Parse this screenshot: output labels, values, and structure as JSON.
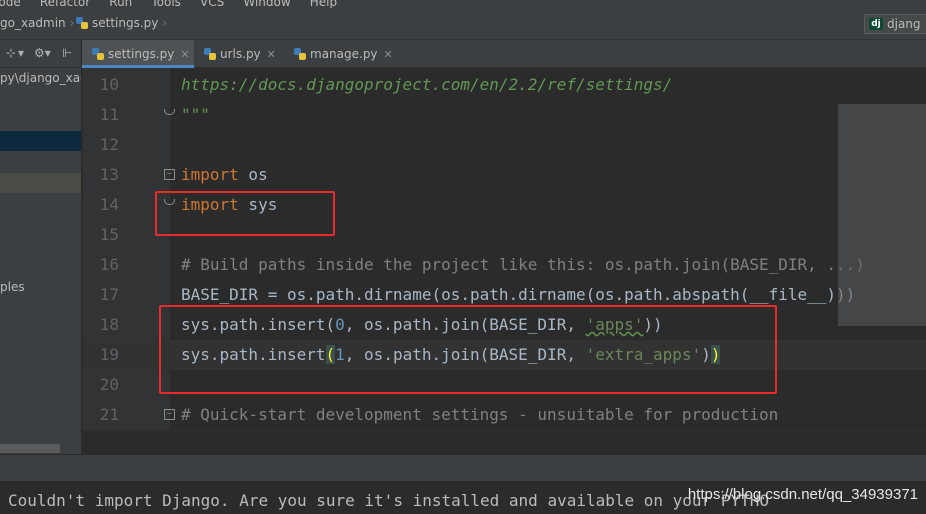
{
  "menubar": {
    "items": [
      "Code",
      "Refactor",
      "Run",
      "Tools",
      "VCS",
      "Window",
      "Help"
    ]
  },
  "breadcrumb": {
    "project": "go_xadmin",
    "file": "settings.py"
  },
  "run_config": {
    "badge": "dj",
    "label": "djang"
  },
  "sidebar": {
    "tool_icons": [
      "⊹",
      "▾",
      "⚙▾",
      "⊩"
    ],
    "path_text": "py\\django_xad",
    "libraries_text": "ples"
  },
  "tabs": [
    {
      "label": "settings.py",
      "active": true
    },
    {
      "label": "urls.py",
      "active": false
    },
    {
      "label": "manage.py",
      "active": false
    }
  ],
  "code_lines": [
    {
      "num": "10",
      "text": "https://docs.djangoproject.com/en/2.2/ref/settings/"
    },
    {
      "num": "11",
      "text": "\"\"\""
    },
    {
      "num": "12",
      "text": ""
    },
    {
      "num": "13",
      "kw": "import",
      "rest": " os"
    },
    {
      "num": "14",
      "kw": "import",
      "rest": " sys"
    },
    {
      "num": "15",
      "text": ""
    },
    {
      "num": "16",
      "text": "# Build paths inside the project like this: os.path.join(BASE_DIR, ...)"
    },
    {
      "num": "17",
      "text": "BASE_DIR = os.path.dirname(os.path.dirname(os.path.abspath(__file__)))"
    },
    {
      "num": "18",
      "a": "sys.path.insert(",
      "n": "0",
      "b": ", os.path.join(BASE_DIR, ",
      "s": "'apps'",
      "c": "))"
    },
    {
      "num": "19",
      "a": "sys.path.insert",
      "p1": "(",
      "n": "1",
      "b": ", os.path.join(BASE_DIR, ",
      "s": "'extra_apps'",
      "c": ")",
      "p2": ")"
    },
    {
      "num": "20",
      "text": ""
    },
    {
      "num": "21",
      "text": "# Quick-start development settings - unsuitable for production"
    }
  ],
  "console": {
    "message": "Couldn't import Django. Are you sure it's installed and available on your PYTHO",
    "watermark": "https://blog.csdn.net/qq_34939371"
  },
  "colors": {
    "keyword": "#cc7832",
    "string": "#6a8759",
    "comment": "#808080",
    "annotation_box": "#e82c2c"
  }
}
